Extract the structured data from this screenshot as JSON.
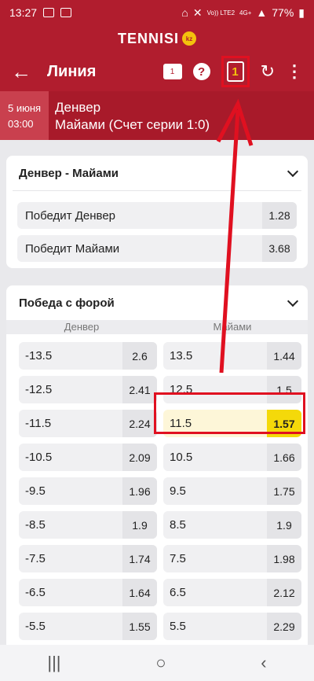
{
  "status": {
    "time": "13:27",
    "battery": "77%",
    "network": "Vo))\nLTE2",
    "gen": "4G+"
  },
  "brand": {
    "name": "TENNISI",
    "region": "kz"
  },
  "toolbar": {
    "back": "←",
    "title": "Линия",
    "messages_count": "1",
    "help": "?",
    "bet_slip_count": "1",
    "refresh": "↻",
    "more": "⋮"
  },
  "event": {
    "date": "5 июня",
    "time": "03:00",
    "team1": "Денвер",
    "team2": "Майами (Счет серии 1:0)"
  },
  "winner_market": {
    "title": "Денвер - Майами",
    "rows": [
      {
        "label": "Победит Денвер",
        "odd": "1.28"
      },
      {
        "label": "Победит Майами",
        "odd": "3.68"
      }
    ]
  },
  "handicap_market": {
    "title": "Победа с форой",
    "col_left": "Денвер",
    "col_right": "Майами",
    "rows": [
      {
        "l_label": "-13.5",
        "l_odd": "2.6",
        "r_label": "13.5",
        "r_odd": "1.44"
      },
      {
        "l_label": "-12.5",
        "l_odd": "2.41",
        "r_label": "12.5",
        "r_odd": "1.5"
      },
      {
        "l_label": "-11.5",
        "l_odd": "2.24",
        "r_label": "11.5",
        "r_odd": "1.57"
      },
      {
        "l_label": "-10.5",
        "l_odd": "2.09",
        "r_label": "10.5",
        "r_odd": "1.66"
      },
      {
        "l_label": "-9.5",
        "l_odd": "1.96",
        "r_label": "9.5",
        "r_odd": "1.75"
      },
      {
        "l_label": "-8.5",
        "l_odd": "1.9",
        "r_label": "8.5",
        "r_odd": "1.9"
      },
      {
        "l_label": "-7.5",
        "l_odd": "1.74",
        "r_label": "7.5",
        "r_odd": "1.98"
      },
      {
        "l_label": "-6.5",
        "l_odd": "1.64",
        "r_label": "6.5",
        "r_odd": "2.12"
      },
      {
        "l_label": "-5.5",
        "l_odd": "1.55",
        "r_label": "5.5",
        "r_odd": "2.29"
      }
    ]
  },
  "navbar": {
    "recents": "|||",
    "home": "○",
    "back": "‹"
  },
  "colors": {
    "brand_red": "#b11d2e",
    "selected_yellow": "#f4d90a",
    "annotation_red": "#e01020"
  }
}
